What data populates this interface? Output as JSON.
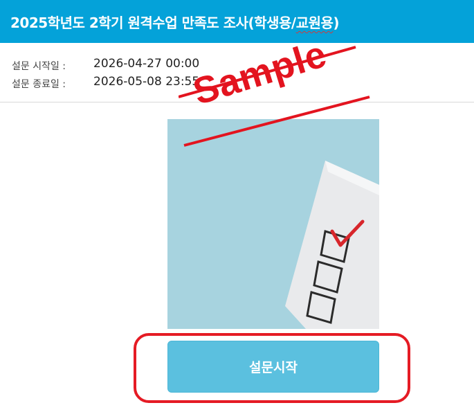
{
  "header": {
    "title_prefix": "2025학년도 2학기 원격수업 만족도 조사(학생용/",
    "title_underlined": "교원용",
    "title_suffix": ")"
  },
  "survey": {
    "start_label": "설문 시작일 :",
    "start_value": "2026-04-27 00:00",
    "end_label": "설문 종료일 :",
    "end_value": "2026-05-08 23:55"
  },
  "image": {
    "icon": "checklist-icon"
  },
  "actions": {
    "start_label": "설문시작"
  },
  "watermark": {
    "text": "Sample",
    "color": "#e3141f"
  },
  "colors": {
    "header": "#04a2d9",
    "button": "#5bc0df",
    "highlight": "#e51b24"
  }
}
